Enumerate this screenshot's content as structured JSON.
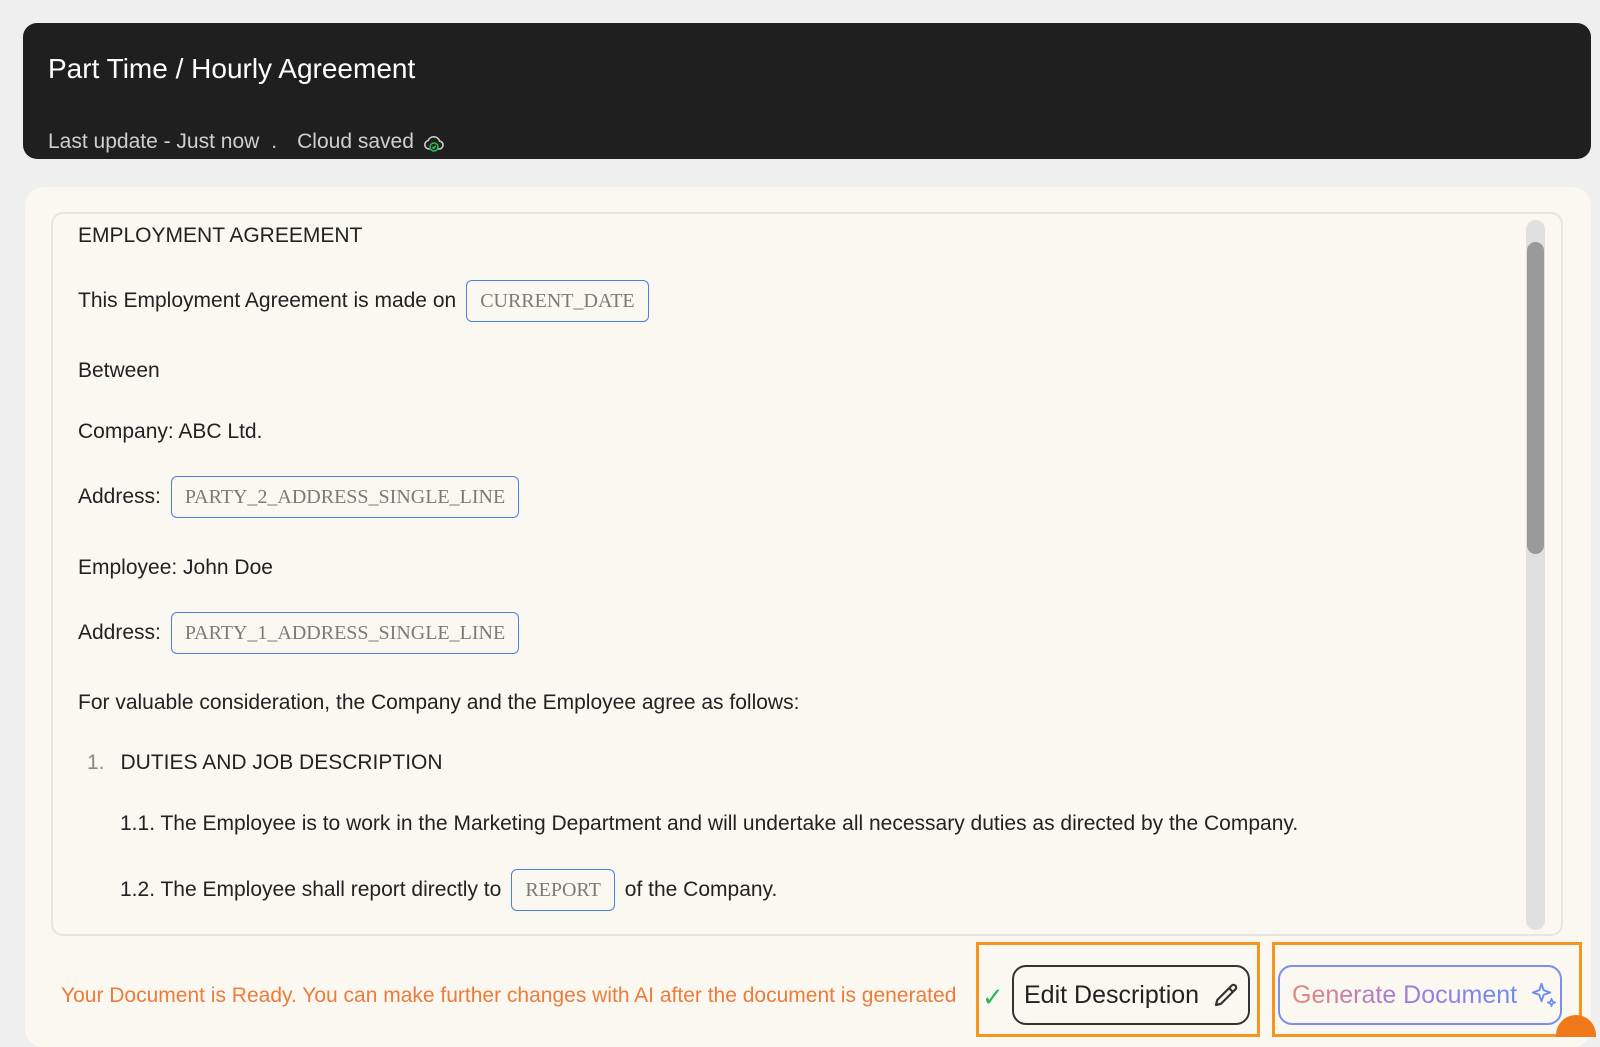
{
  "header": {
    "title": "Part Time / Hourly Agreement",
    "last_update": "Last update - Just now",
    "separator": ".",
    "cloud_status": "Cloud saved"
  },
  "document": {
    "heading": "EMPLOYMENT AGREEMENT",
    "made_on_label": "This Employment Agreement is made on",
    "made_on_field": "CURRENT_DATE",
    "between": "Between",
    "company": "Company: ABC Ltd.",
    "address_label_1": "Address:",
    "address_field_1": "PARTY_2_ADDRESS_SINGLE_LINE",
    "employee": "Employee: John Doe",
    "address_label_2": "Address:",
    "address_field_2": "PARTY_1_ADDRESS_SINGLE_LINE",
    "consideration": "For valuable consideration, the Company and the Employee agree as follows:",
    "section_1_number": "1.",
    "section_1_title": "DUTIES AND JOB DESCRIPTION",
    "clause_1_1": "1.1. The Employee is to work in the Marketing Department and will undertake all necessary duties as directed by the Company.",
    "clause_1_2_prefix": "1.2. The Employee shall report directly to",
    "clause_1_2_field": "REPORT",
    "clause_1_2_suffix": "of the Company."
  },
  "footer": {
    "message": "Your Document is Ready. You can make further changes with AI after the document is generated",
    "check_glyph": "✓",
    "edit_button": "Edit Description",
    "generate_button": "Generate Document"
  },
  "colors": {
    "header_bg": "#1f1f1f",
    "panel_bg": "#faf8f1",
    "field_border": "#4a7fe0",
    "message": "#ee7b3a",
    "highlight": "#f7941d",
    "check": "#2db84f"
  },
  "icons": [
    "cloud-check-icon",
    "check-icon",
    "pencil-icon",
    "sparkle-icon"
  ]
}
